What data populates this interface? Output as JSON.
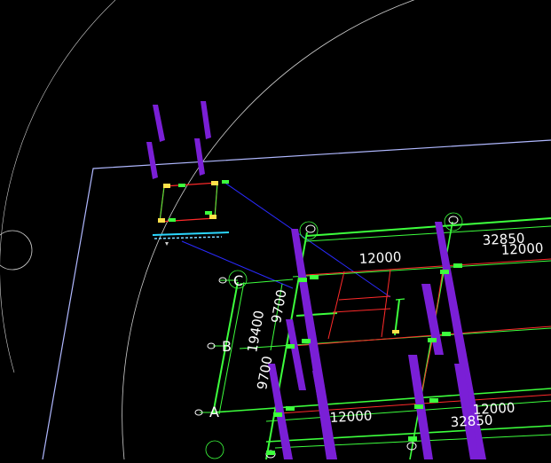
{
  "app": {
    "canvas_background": "#000000",
    "colors": {
      "grid_line": "#3dff3d",
      "column": "#7a1fd6",
      "beam": "#ff2a2a",
      "leader": "#2a2aff",
      "text": "#ffffff",
      "boundary": "#b0b8ff",
      "arc": "#cfcfcf",
      "label_yellow": "#ffe14a",
      "label_cyan": "#2ad7ff"
    }
  },
  "drawing": {
    "axis_labels": {
      "c": "C",
      "b": "B",
      "a": "A"
    },
    "dimensions": {
      "top_span": "12000",
      "overall_top": "32850",
      "right_span": "12000",
      "vertical_upper": "9700",
      "vertical_total": "19400",
      "vertical_lower": "9700",
      "bottom_span": "12000",
      "bottom_right_span": "12000",
      "overall_bottom": "32850"
    }
  }
}
